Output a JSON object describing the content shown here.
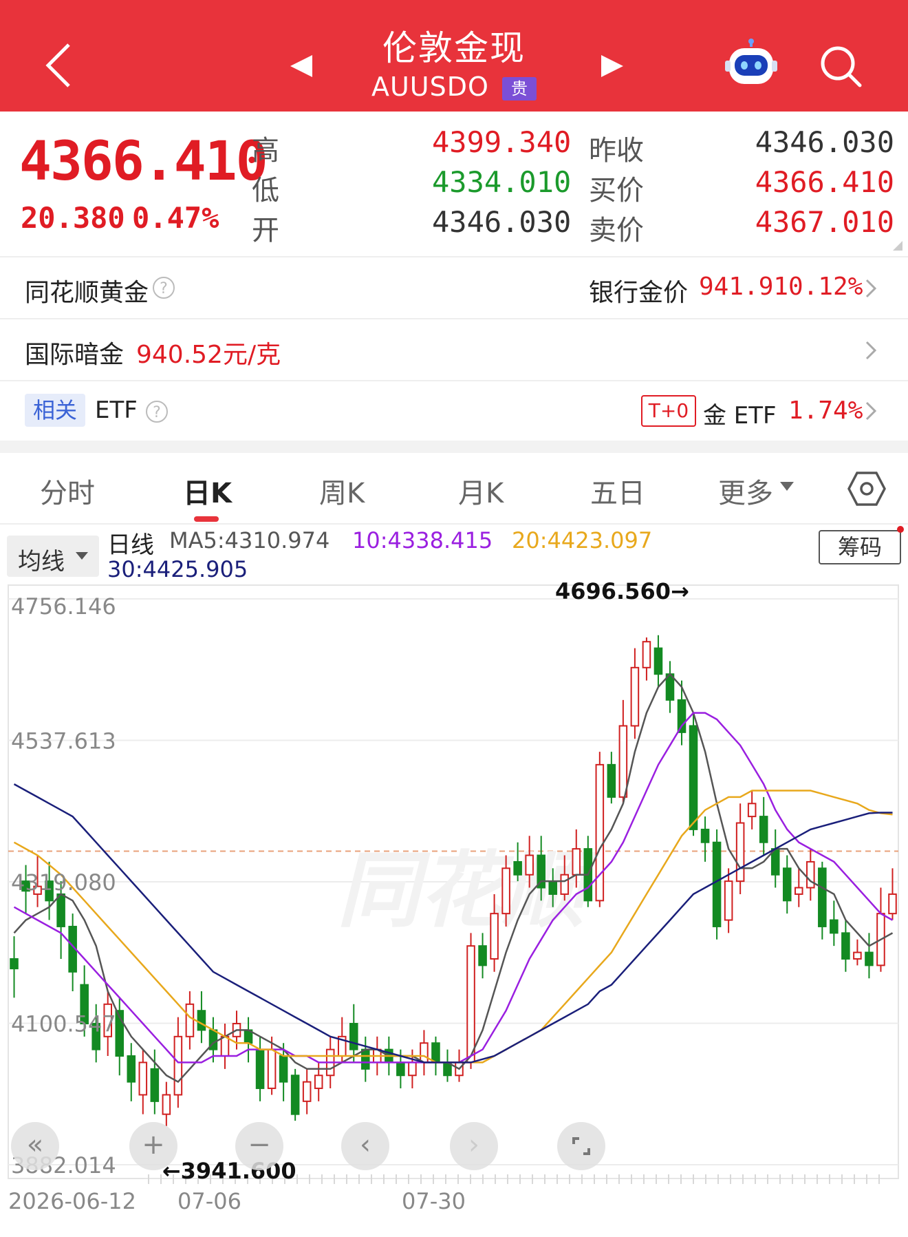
{
  "header": {
    "title": "伦敦金现",
    "symbol": "AUUSDO",
    "badge": "贵",
    "back_icon": "chevron-left-icon",
    "prev_icon": "triangle-left-icon",
    "next_icon": "triangle-right-icon",
    "robot_icon": "robot-assistant-icon",
    "search_icon": "search-icon",
    "bg_color": "#e8333b"
  },
  "quote": {
    "price": "4366.410",
    "change": "20.380",
    "change_pct": "0.47%",
    "high_label": "高",
    "high": "4399.340",
    "low_label": "低",
    "low": "4334.010",
    "open_label": "开",
    "open": "4346.030",
    "prev_close_label": "昨收",
    "prev_close": "4346.030",
    "bid_label": "买价",
    "bid": "4366.410",
    "ask_label": "卖价",
    "ask": "4367.010"
  },
  "rows": {
    "ths_gold_label": "同花顺黄金",
    "bank_gold_label": "银行金价",
    "bank_gold_price": "941.91",
    "bank_gold_pct": "0.12%",
    "intl_dark_label": "国际暗金",
    "intl_dark_price": "940.52元/克",
    "related_tag": "相关",
    "etf_label": "ETF",
    "t0_tag": "T+0",
    "gold_etf_label": "金 ETF",
    "gold_etf_pct": "1.74%"
  },
  "tabs": [
    {
      "label": "分时",
      "active": false
    },
    {
      "label": "日K",
      "active": true
    },
    {
      "label": "周K",
      "active": false
    },
    {
      "label": "月K",
      "active": false
    },
    {
      "label": "五日",
      "active": false
    },
    {
      "label": "更多",
      "active": false
    }
  ],
  "indicator_bar": {
    "ma_select": "均线",
    "period": "日线",
    "ma5": "MA5:4310.974",
    "ma10": "10:4338.415",
    "ma20": "20:4423.097",
    "ma30": "30:4425.905",
    "chips_button": "筹码",
    "colors": {
      "ma5": "#555555",
      "ma10": "#9a1fe0",
      "ma20": "#e8a81c",
      "ma30": "#1a1f7a"
    }
  },
  "chart_data": {
    "type": "candlestick",
    "y_tick_labels": [
      "4756.146",
      "4537.613",
      "4319.080",
      "4100.547",
      "3882.014"
    ],
    "ylim": [
      3882.014,
      4756.146
    ],
    "x_tick_labels": [
      "2026-06-12",
      "07-06",
      "07-30"
    ],
    "max_annotation": "4696.560→",
    "min_annotation": "←3941.600",
    "last_price_line": 4366.41,
    "candles": [
      [
        4200,
        4185,
        4235,
        4140
      ],
      [
        4320,
        4305,
        4345,
        4270
      ],
      [
        4300,
        4312,
        4360,
        4280
      ],
      [
        4320,
        4290,
        4350,
        4260
      ],
      [
        4300,
        4250,
        4320,
        4200
      ],
      [
        4250,
        4180,
        4270,
        4150
      ],
      [
        4160,
        4100,
        4190,
        4080
      ],
      [
        4100,
        4060,
        4130,
        4040
      ],
      [
        4080,
        4130,
        4150,
        4050
      ],
      [
        4120,
        4050,
        4140,
        4020
      ],
      [
        4050,
        4010,
        4070,
        3980
      ],
      [
        3990,
        4040,
        4060,
        3960
      ],
      [
        4030,
        3980,
        4060,
        3960
      ],
      [
        3960,
        3990,
        4010,
        3941.6
      ],
      [
        3990,
        4080,
        4110,
        3970
      ],
      [
        4080,
        4130,
        4150,
        4060
      ],
      [
        4120,
        4090,
        4150,
        4070
      ],
      [
        4090,
        4060,
        4110,
        4040
      ],
      [
        4050,
        4080,
        4100,
        4030
      ],
      [
        4080,
        4100,
        4120,
        4060
      ],
      [
        4090,
        4070,
        4110,
        4040
      ],
      [
        4060,
        4000,
        4080,
        3980
      ],
      [
        4000,
        4060,
        4080,
        3990
      ],
      [
        4050,
        4010,
        4070,
        3980
      ],
      [
        4020,
        3960,
        4030,
        3950
      ],
      [
        3980,
        4010,
        4030,
        3960
      ],
      [
        4000,
        4020,
        4040,
        3980
      ],
      [
        4020,
        4060,
        4080,
        4000
      ],
      [
        4050,
        4080,
        4110,
        4040
      ],
      [
        4100,
        4060,
        4130,
        4040
      ],
      [
        4060,
        4030,
        4080,
        4010
      ],
      [
        4040,
        4060,
        4080,
        4020
      ],
      [
        4060,
        4040,
        4080,
        4020
      ],
      [
        4040,
        4020,
        4060,
        4000
      ],
      [
        4020,
        4040,
        4060,
        4000
      ],
      [
        4040,
        4070,
        4090,
        4020
      ],
      [
        4070,
        4040,
        4080,
        4020
      ],
      [
        4040,
        4020,
        4060,
        4010
      ],
      [
        4020,
        4040,
        4060,
        4010
      ],
      [
        4040,
        4220,
        4240,
        4030
      ],
      [
        4220,
        4190,
        4240,
        4170
      ],
      [
        4200,
        4270,
        4300,
        4180
      ],
      [
        4270,
        4340,
        4360,
        4250
      ],
      [
        4350,
        4330,
        4380,
        4320
      ],
      [
        4330,
        4360,
        4390,
        4310
      ],
      [
        4360,
        4310,
        4390,
        4290
      ],
      [
        4320,
        4300,
        4340,
        4280
      ],
      [
        4300,
        4330,
        4360,
        4290
      ],
      [
        4330,
        4370,
        4400,
        4310
      ],
      [
        4370,
        4290,
        4390,
        4280
      ],
      [
        4290,
        4500,
        4520,
        4280
      ],
      [
        4500,
        4450,
        4520,
        4440
      ],
      [
        4450,
        4560,
        4600,
        4440
      ],
      [
        4560,
        4650,
        4680,
        4540
      ],
      [
        4650,
        4690,
        4696.56,
        4630
      ],
      [
        4680,
        4640,
        4700,
        4620
      ],
      [
        4640,
        4600,
        4660,
        4580
      ],
      [
        4600,
        4550,
        4630,
        4530
      ],
      [
        4560,
        4400,
        4580,
        4390
      ],
      [
        4400,
        4380,
        4420,
        4350
      ],
      [
        4380,
        4250,
        4400,
        4230
      ],
      [
        4260,
        4320,
        4340,
        4240
      ],
      [
        4320,
        4410,
        4440,
        4300
      ],
      [
        4420,
        4440,
        4460,
        4400
      ],
      [
        4420,
        4380,
        4450,
        4360
      ],
      [
        4370,
        4330,
        4400,
        4310
      ],
      [
        4340,
        4290,
        4360,
        4270
      ],
      [
        4300,
        4310,
        4340,
        4280
      ],
      [
        4310,
        4350,
        4370,
        4290
      ],
      [
        4340,
        4250,
        4350,
        4230
      ],
      [
        4260,
        4240,
        4290,
        4220
      ],
      [
        4240,
        4200,
        4260,
        4180
      ],
      [
        4200,
        4210,
        4230,
        4190
      ],
      [
        4210,
        4190,
        4240,
        4170
      ],
      [
        4190,
        4270,
        4310,
        4180
      ],
      [
        4270,
        4300,
        4340,
        4260
      ]
    ],
    "ma5": [
      4240,
      4260,
      4270,
      4280,
      4300,
      4290,
      4260,
      4220,
      4150,
      4110,
      4080,
      4060,
      4040,
      4020,
      4010,
      4030,
      4050,
      4070,
      4080,
      4090,
      4090,
      4080,
      4070,
      4060,
      4040,
      4030,
      4030,
      4030,
      4040,
      4050,
      4060,
      4060,
      4050,
      4050,
      4050,
      4040,
      4040,
      4040,
      4030,
      4050,
      4090,
      4150,
      4210,
      4260,
      4300,
      4320,
      4320,
      4320,
      4330,
      4330,
      4370,
      4400,
      4440,
      4520,
      4580,
      4620,
      4640,
      4620,
      4580,
      4520,
      4440,
      4370,
      4340,
      4340,
      4350,
      4370,
      4370,
      4340,
      4320,
      4310,
      4300,
      4260,
      4240,
      4220,
      4230,
      4240
    ],
    "ma10": [
      4280,
      4270,
      4260,
      4250,
      4240,
      4220,
      4200,
      4180,
      4160,
      4140,
      4120,
      4100,
      4080,
      4060,
      4040,
      4040,
      4040,
      4050,
      4050,
      4050,
      4060,
      4060,
      4060,
      4060,
      4050,
      4050,
      4040,
      4040,
      4040,
      4040,
      4040,
      4040,
      4040,
      4040,
      4040,
      4040,
      4040,
      4040,
      4040,
      4050,
      4060,
      4090,
      4120,
      4160,
      4200,
      4230,
      4260,
      4280,
      4300,
      4310,
      4330,
      4350,
      4380,
      4420,
      4460,
      4500,
      4530,
      4560,
      4580,
      4580,
      4570,
      4550,
      4530,
      4500,
      4470,
      4430,
      4400,
      4380,
      4370,
      4360,
      4350,
      4330,
      4310,
      4290,
      4270,
      4260
    ],
    "ma20": [
      4380,
      4370,
      4360,
      4345,
      4330,
      4310,
      4290,
      4270,
      4250,
      4230,
      4210,
      4190,
      4170,
      4150,
      4130,
      4110,
      4100,
      4090,
      4080,
      4070,
      4070,
      4060,
      4060,
      4050,
      4050,
      4050,
      4050,
      4050,
      4050,
      4050,
      4050,
      4050,
      4050,
      4050,
      4050,
      4050,
      4040,
      4040,
      4040,
      4040,
      4040,
      4050,
      4060,
      4070,
      4080,
      4090,
      4110,
      4130,
      4150,
      4170,
      4190,
      4210,
      4240,
      4270,
      4300,
      4330,
      4360,
      4390,
      4410,
      4430,
      4440,
      4450,
      4450,
      4460,
      4460,
      4460,
      4460,
      4460,
      4460,
      4455,
      4450,
      4445,
      4440,
      4430,
      4425,
      4423
    ],
    "ma30": [
      4470,
      4460,
      4450,
      4440,
      4430,
      4420,
      4400,
      4380,
      4360,
      4340,
      4320,
      4300,
      4280,
      4260,
      4240,
      4220,
      4200,
      4180,
      4170,
      4160,
      4150,
      4140,
      4130,
      4120,
      4110,
      4100,
      4090,
      4080,
      4075,
      4070,
      4065,
      4060,
      4055,
      4050,
      4045,
      4040,
      4040,
      4040,
      4040,
      4040,
      4045,
      4050,
      4060,
      4070,
      4080,
      4090,
      4100,
      4110,
      4120,
      4130,
      4150,
      4160,
      4180,
      4200,
      4220,
      4240,
      4260,
      4280,
      4300,
      4310,
      4320,
      4330,
      4340,
      4350,
      4360,
      4370,
      4380,
      4390,
      4400,
      4405,
      4410,
      4415,
      4420,
      4425,
      4426,
      4426
    ]
  },
  "controls": {
    "rewind_icon": "double-chevron-left-icon",
    "zoom_in_icon": "plus-icon",
    "zoom_out_icon": "minus-icon",
    "prev_icon": "chevron-left-icon",
    "next_icon": "chevron-right-icon",
    "fullscreen_icon": "fullscreen-icon"
  }
}
